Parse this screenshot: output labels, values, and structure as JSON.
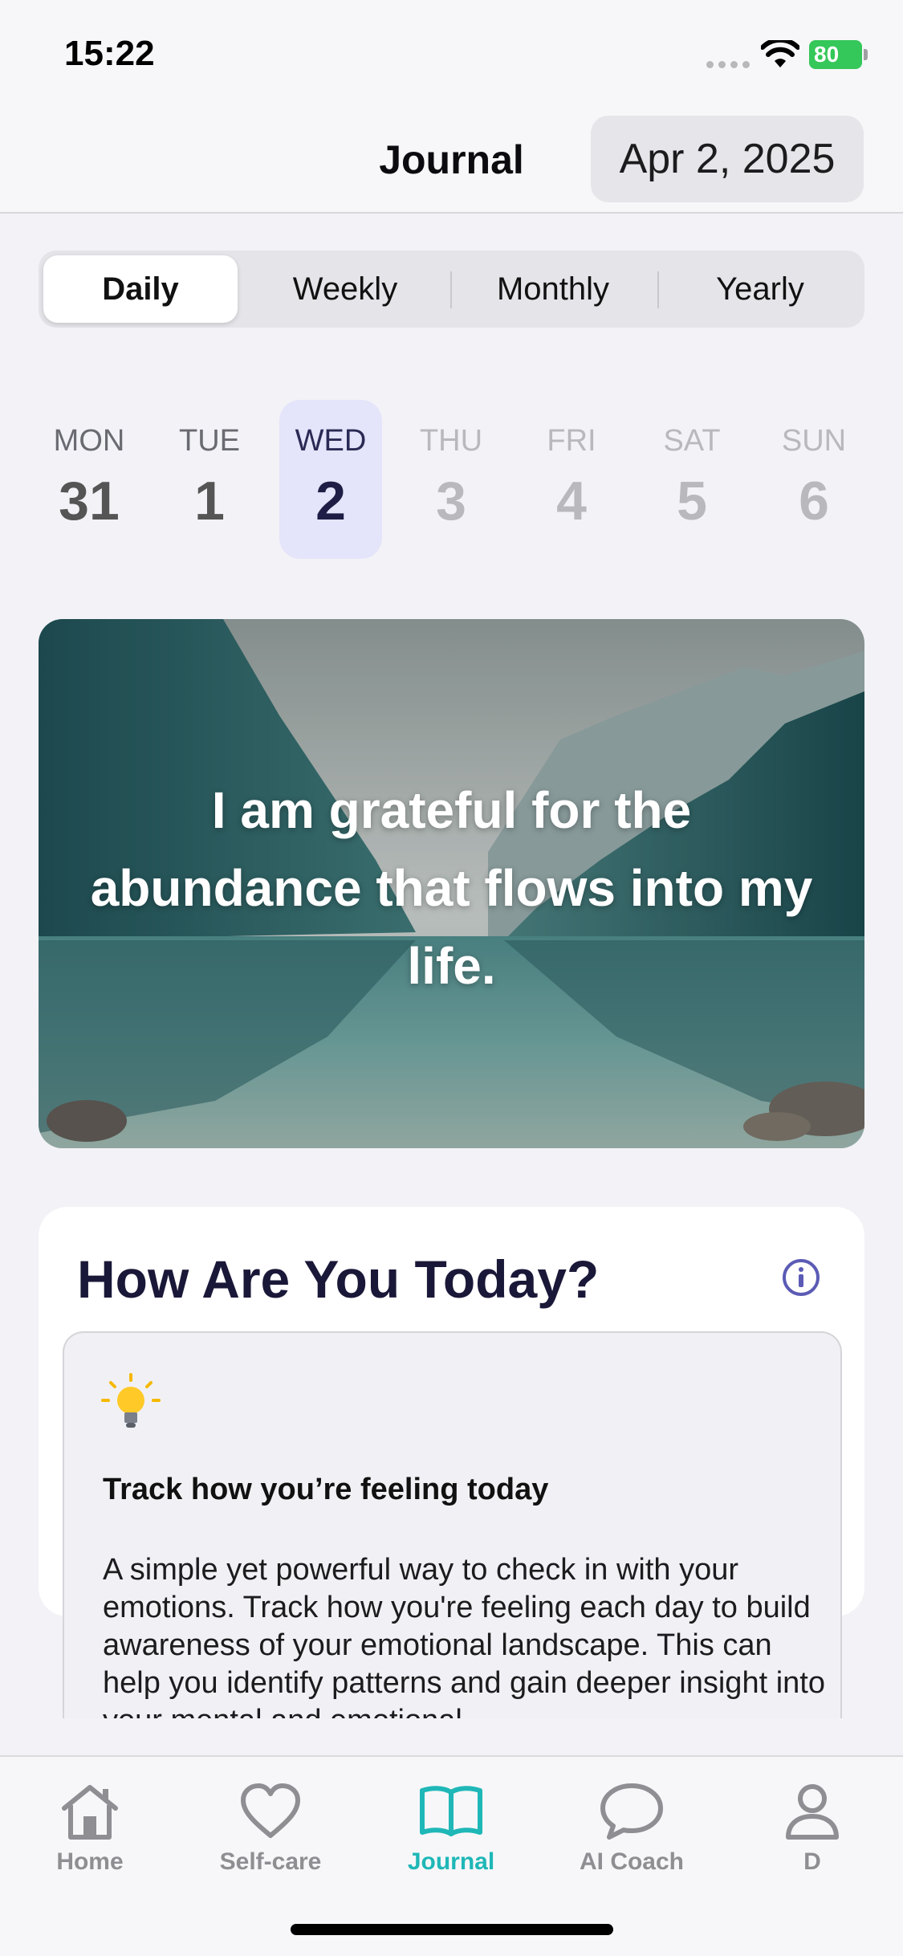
{
  "status_bar": {
    "time": "15:22",
    "battery": "80"
  },
  "header": {
    "title": "Journal",
    "date": "Apr 2, 2025"
  },
  "segments": [
    {
      "label": "Daily",
      "active": true
    },
    {
      "label": "Weekly",
      "active": false
    },
    {
      "label": "Monthly",
      "active": false
    },
    {
      "label": "Yearly",
      "active": false
    }
  ],
  "week": [
    {
      "day": "MON",
      "num": "31"
    },
    {
      "day": "TUE",
      "num": "1"
    },
    {
      "day": "WED",
      "num": "2",
      "selected": true
    },
    {
      "day": "THU",
      "num": "3"
    },
    {
      "day": "FRI",
      "num": "4"
    },
    {
      "day": "SAT",
      "num": "5"
    },
    {
      "day": "SUN",
      "num": "6"
    }
  ],
  "affirmation": {
    "text": "I am grateful for the abundance that flows into my life."
  },
  "mood_card": {
    "title": "How Are You Today?",
    "info_heading": "Track how you’re feeling today",
    "info_body": "A simple yet powerful way to check in with your emotions. Track how you're feeling each day to build awareness of your emotional landscape. This can help you identify patterns and gain deeper insight into your mental and emotional"
  },
  "tabs": [
    {
      "label": "Home",
      "icon": "house-icon",
      "active": false
    },
    {
      "label": "Self-care",
      "icon": "heart-icon",
      "active": false
    },
    {
      "label": "Journal",
      "icon": "book-icon",
      "active": true
    },
    {
      "label": "AI Coach",
      "icon": "chat-bubble-icon",
      "active": false
    },
    {
      "label": "D",
      "icon": "person-icon",
      "active": false
    }
  ],
  "colors": {
    "accent_teal": "#1fb7b7",
    "selected_day_bg": "#e4e4fa",
    "battery_green": "#34c759",
    "info_purple": "#5b5bb5"
  }
}
